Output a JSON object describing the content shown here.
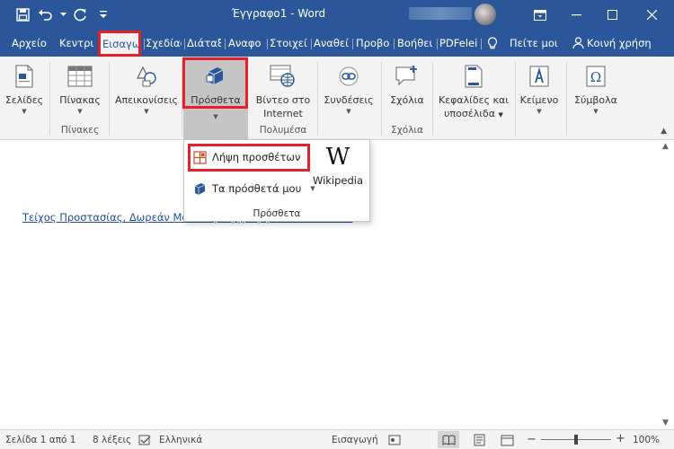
{
  "titlebar": {
    "title": "Έγγραφο1 - Word",
    "colors": {
      "bar": "#2b579a",
      "highlight": "#e3212a"
    }
  },
  "tabs": [
    {
      "label": "Αρχείο"
    },
    {
      "label": "Κεντρι"
    },
    {
      "label": "Εισαγω",
      "active": true
    },
    {
      "label": "Σχεδίας"
    },
    {
      "label": "Διάταξ"
    },
    {
      "label": "Αναφο"
    },
    {
      "label": "Στοιχεί"
    },
    {
      "label": "Αναθεί"
    },
    {
      "label": "Προβο"
    },
    {
      "label": "Βοήθει"
    },
    {
      "label": "PDFelei"
    },
    {
      "label": "Πείτε μοι"
    },
    {
      "label": "Κοινή χρήση"
    }
  ],
  "ribbon": {
    "pages": "Σελίδες",
    "table": "Πίνακας",
    "tables_group": "Πίνακες",
    "illustrations": "Απεικονίσεις",
    "addins": "Πρόσθετα",
    "online_video_line1": "Βίντεο στο",
    "online_video_line2": "Internet",
    "media_group": "Πολυμέσα",
    "links": "Συνδέσεις",
    "comment": "Σχόλια",
    "comments_group": "Σχόλια",
    "header_footer_line1": "Κεφαλίδες και",
    "header_footer_line2": "υποσέλιδα",
    "text": "Κείμενο",
    "symbols": "Σύμβολα"
  },
  "dropdown": {
    "get_addins": "Λήψη προσθέτων",
    "my_addins": "Τα πρόσθετά μου",
    "wikipedia_logo": "W",
    "wikipedia": "Wikipedia",
    "group_label": "Πρόσθετα"
  },
  "document": {
    "link_text": "Τείχος Προστασίας, Δωρεάν Μουσική, Εγγραφή από Βίντεο VLC"
  },
  "statusbar": {
    "page": "Σελίδα 1 από 1",
    "words": "8 λέξεις",
    "language": "Ελληνικά",
    "mode": "Εισαγωγή",
    "zoom": "100%"
  },
  "icons": {
    "save": "save-icon",
    "undo": "undo-icon",
    "redo": "redo-icon",
    "customize": "customize-qat-icon",
    "minimize": "minimize-icon",
    "maximize": "maximize-icon",
    "close": "close-icon",
    "lightbulb": "lightbulb-icon",
    "share": "share-user-icon"
  }
}
